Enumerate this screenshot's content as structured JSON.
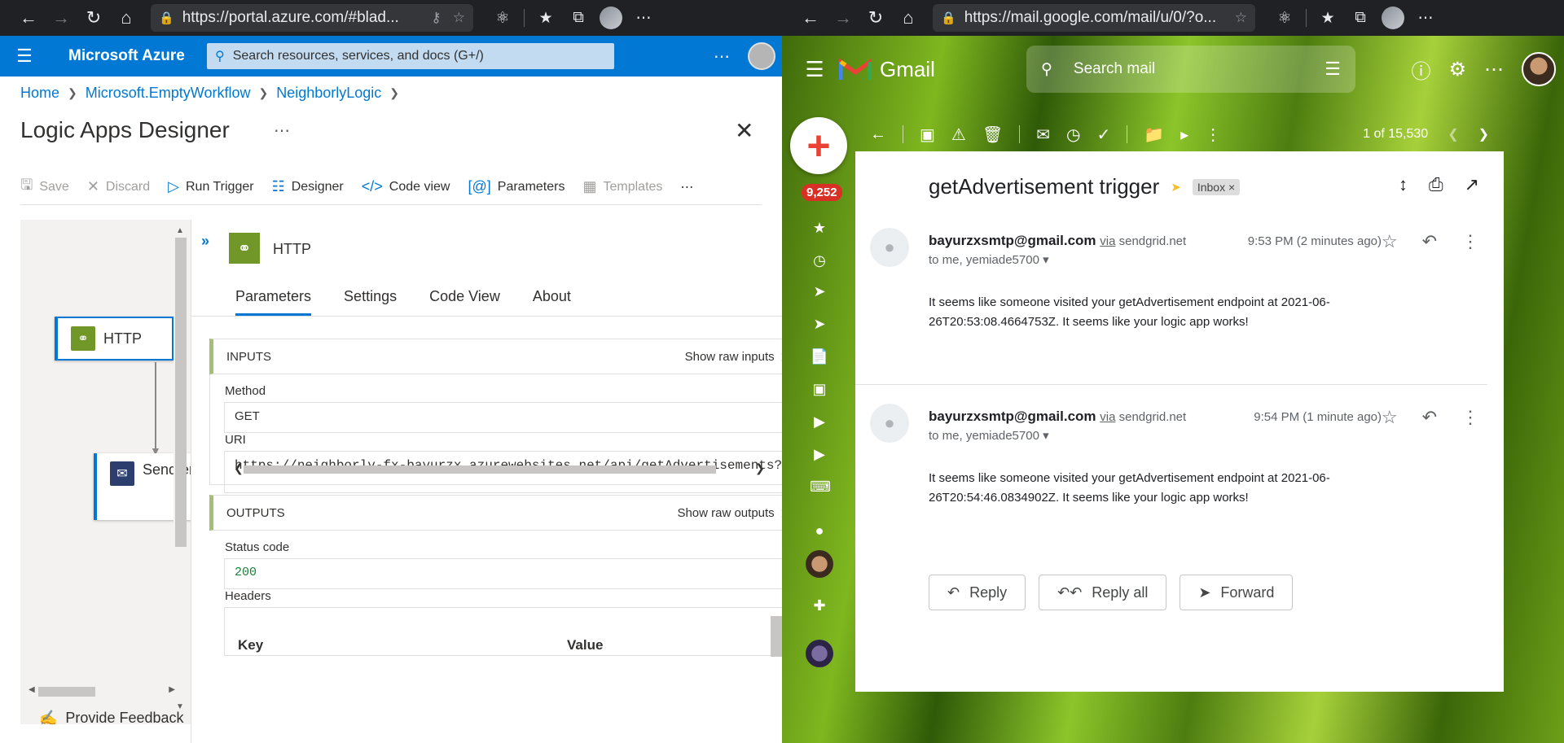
{
  "left_browser": {
    "url": "https://portal.azure.com/#blad..."
  },
  "right_browser": {
    "url": "https://mail.google.com/mail/u/0/?o..."
  },
  "azure": {
    "brand": "Microsoft Azure",
    "search_placeholder": "Search resources, services, and docs (G+/)",
    "breadcrumb": [
      "Home",
      "Microsoft.EmptyWorkflow",
      "NeighborlyLogic"
    ],
    "page_title": "Logic Apps Designer",
    "toolbar": {
      "save": "Save",
      "discard": "Discard",
      "run_trigger": "Run Trigger",
      "designer": "Designer",
      "code_view": "Code view",
      "parameters": "Parameters",
      "templates": "Templates"
    },
    "canvas": {
      "http_card": "HTTP",
      "email_card": "Send email"
    },
    "feedback": "Provide Feedback",
    "panel": {
      "title": "HTTP",
      "tabs": [
        "Parameters",
        "Settings",
        "Code View",
        "About"
      ],
      "inputs": {
        "header": "INPUTS",
        "raw_link": "Show raw inputs",
        "method_label": "Method",
        "method_value": "GET",
        "uri_label": "URI",
        "uri_value": "https://neighborly-fx-bayurzx.azurewebsites.net/api/getAdvertisements?"
      },
      "outputs": {
        "header": "OUTPUTS",
        "raw_link": "Show raw outputs",
        "status_label": "Status code",
        "status_value": "200",
        "headers_label": "Headers",
        "key_col": "Key",
        "value_col": "Value"
      }
    }
  },
  "gmail": {
    "logo_text": "Gmail",
    "search_placeholder": "Search mail",
    "unread_count": "9,252",
    "pagination": "1 of 15,530",
    "subject": "getAdvertisement trigger",
    "inbox_chip": "Inbox",
    "messages": [
      {
        "from": "bayurzxsmtp@gmail.com",
        "via_word": "via",
        "via_domain": "sendgrid.net",
        "to": "to me, yemiade5700",
        "time": "9:53 PM (2 minutes ago)",
        "body": "It seems like someone visited your getAdvertisement endpoint at 2021-06-26T20:53:08.4664753Z. It seems like your logic app works!"
      },
      {
        "from": "bayurzxsmtp@gmail.com",
        "via_word": "via",
        "via_domain": "sendgrid.net",
        "to": "to me, yemiade5700",
        "time": "9:54 PM (1 minute ago)",
        "body": "It seems like someone visited your getAdvertisement endpoint at 2021-06-26T20:54:46.0834902Z. It seems like your logic app works!"
      }
    ],
    "reply_buttons": {
      "reply": "Reply",
      "reply_all": "Reply all",
      "forward": "Forward"
    }
  }
}
